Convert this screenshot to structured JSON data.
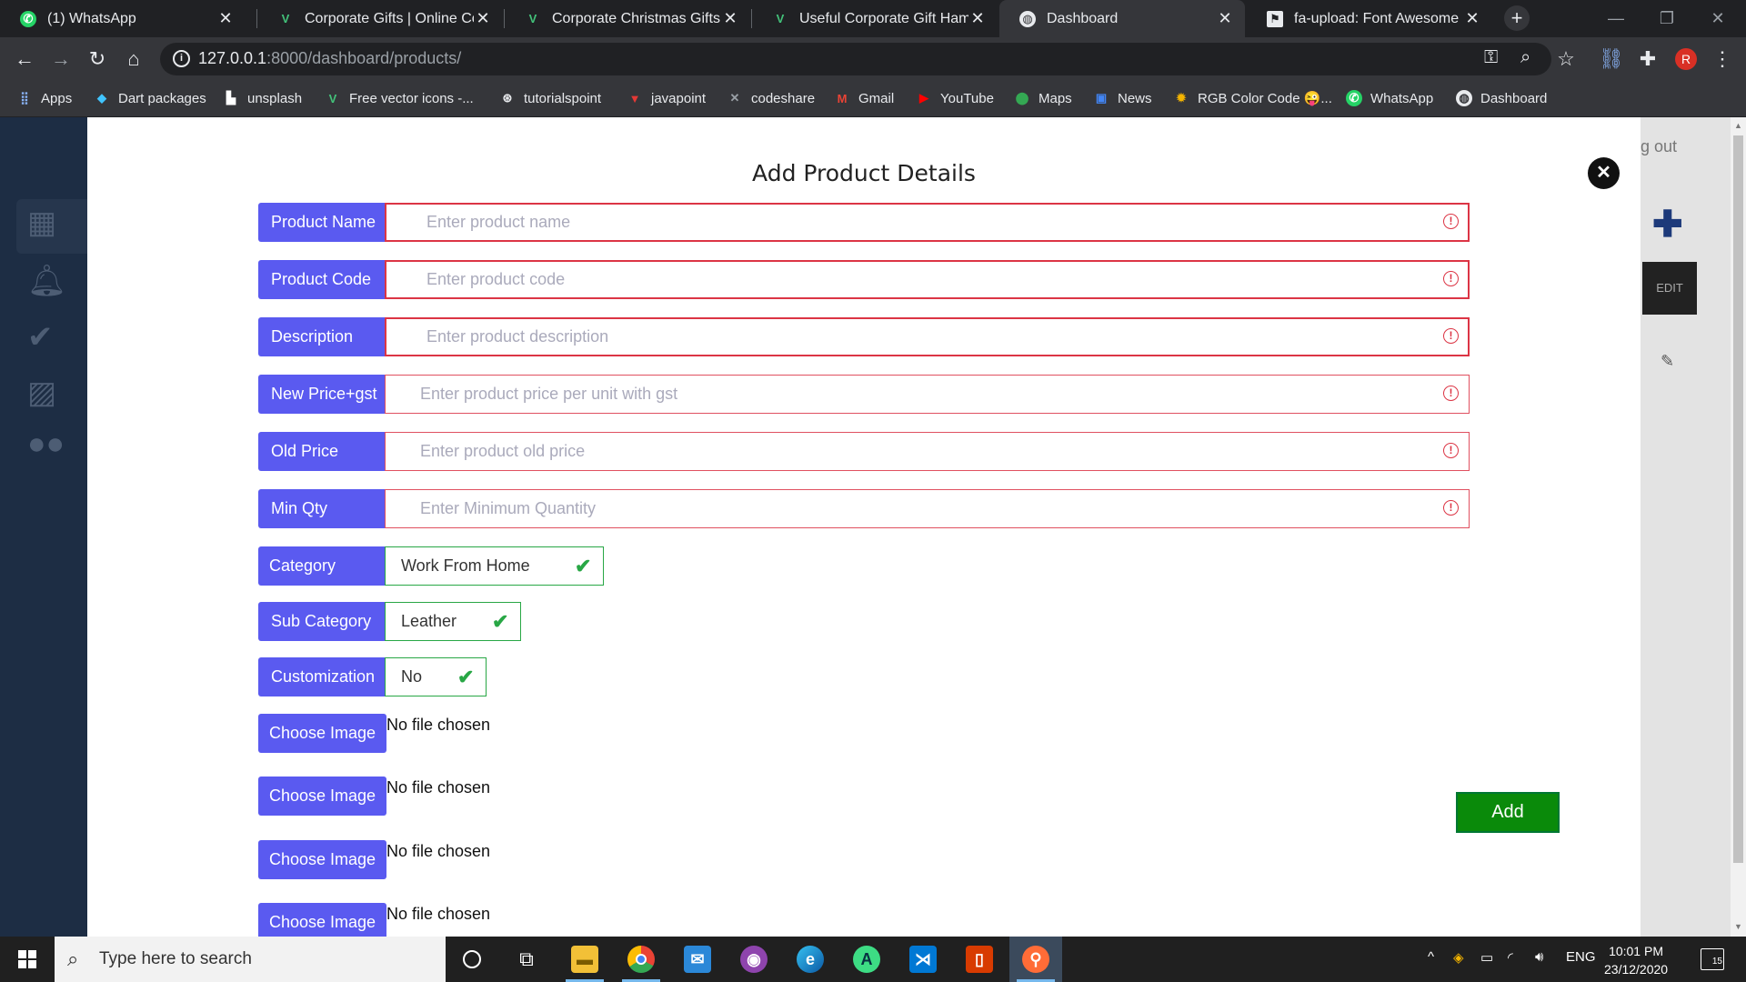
{
  "browser": {
    "tabs": [
      {
        "title": "(1) WhatsApp",
        "icon": "whatsapp-icon"
      },
      {
        "title": "Corporate Gifts | Online Corp",
        "icon": "v-logo-icon"
      },
      {
        "title": "Corporate Christmas Gifts Fo",
        "icon": "v-logo-icon"
      },
      {
        "title": "Useful Corporate Gift Hampe",
        "icon": "v-logo-icon"
      },
      {
        "title": "Dashboard",
        "icon": "globe-icon"
      },
      {
        "title": "fa-upload: Font Awesome Ic",
        "icon": "flag-icon"
      }
    ],
    "active_tab": 4,
    "url_host": "127.0.0.1",
    "url_rest": ":8000/dashboard/products/",
    "profile_initial": "R",
    "bookmarks": [
      "Apps",
      "Dart packages",
      "unsplash",
      "Free vector icons -...",
      "tutorialspoint",
      "javapoint",
      "codeshare",
      "Gmail",
      "YouTube",
      "Maps",
      "News",
      "RGB Color Code 😜...",
      "WhatsApp",
      "Dashboard"
    ]
  },
  "background": {
    "logout_text": "g out",
    "edit_label": "EDIT"
  },
  "modal": {
    "title": "Add Product Details",
    "fields": [
      {
        "label": "Product Name",
        "placeholder": "Enter product name"
      },
      {
        "label": "Product Code",
        "placeholder": "Enter product code"
      },
      {
        "label": "Description",
        "placeholder": "Enter product description"
      },
      {
        "label": "New Price+gst",
        "placeholder": "Enter product price per unit with gst"
      },
      {
        "label": "Old Price",
        "placeholder": "Enter product old price"
      },
      {
        "label": "Min Qty",
        "placeholder": "Enter Minimum Quantity"
      }
    ],
    "selects": [
      {
        "label": "Category",
        "value": "Work From Home"
      },
      {
        "label": "Sub Category",
        "value": "Leather"
      },
      {
        "label": "Customization",
        "value": "No"
      }
    ],
    "file_inputs": [
      {
        "button": "Choose Image",
        "status": "No file chosen"
      },
      {
        "button": "Choose Image",
        "status": "No file chosen"
      },
      {
        "button": "Choose Image",
        "status": "No file chosen"
      },
      {
        "button": "Choose Image",
        "status": "No file chosen"
      }
    ],
    "add_button": "Add",
    "colors": {
      "label_bg": "#5a5af0",
      "error": "#dc3545",
      "valid": "#28a745",
      "add_bg": "#0a8a0a"
    }
  },
  "taskbar": {
    "search_placeholder": "Type here to search",
    "language": "ENG",
    "time": "10:01 PM",
    "date": "23/12/2020",
    "notification_count": "15"
  }
}
